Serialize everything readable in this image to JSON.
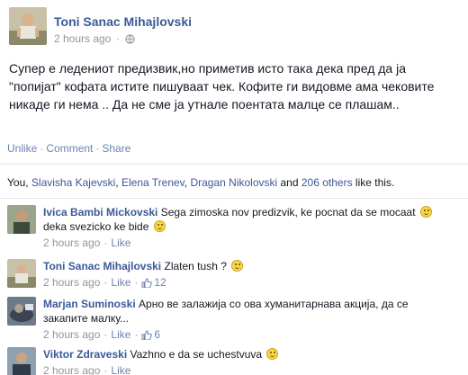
{
  "post": {
    "author": "Toni Sanac Mihajlovski",
    "time": "2 hours ago",
    "privacy_icon": "globe-icon",
    "text": "Супер е ледениот предизвик,но приметив исто така дека пред да ја \"попијат\" кофата истите пишуваат чек. Кофите ги видовме ама чековите никаде ги нема .. Да не сме ја утнале поентата малце се плашам..",
    "actions": {
      "unlike": "Unlike",
      "comment": "Comment",
      "share": "Share",
      "sep": "·"
    },
    "likes": {
      "prefix": "You, ",
      "names": [
        "Slavisha Kajevski",
        "Elena Trenev",
        "Dragan Nikolovski"
      ],
      "sep1": ", ",
      "sep2": ", ",
      "and": " and ",
      "others": "206 others",
      "suffix": " like this."
    }
  },
  "comments": [
    {
      "name": "Ivica Bambi Mickovski",
      "text": "Sega zimoska nov predizvik, ke pocnat da se mocaat",
      "text2": "deka svezicko ke bide",
      "time": "2 hours ago",
      "like": "Like",
      "like_count": ""
    },
    {
      "name": "Toni Sanac Mihajlovski",
      "text": "Zlaten tush ?",
      "text2": "",
      "time": "2 hours ago",
      "like": "Like",
      "like_count": "12"
    },
    {
      "name": "Marjan Suminoski",
      "text": "Арно ве залажија со ова хуманитарнава акција, да се",
      "text2": "закапите малку...",
      "time": "2 hours ago",
      "like": "Like",
      "like_count": "6"
    },
    {
      "name": "Viktor Zdraveski",
      "text": "Vazhno e da se uchestvuva",
      "text2": "",
      "time": "2 hours ago",
      "like": "Like",
      "like_count": ""
    }
  ],
  "colors": {
    "link": "#3b5998",
    "action": "#6d84b4",
    "muted": "#90949c"
  }
}
